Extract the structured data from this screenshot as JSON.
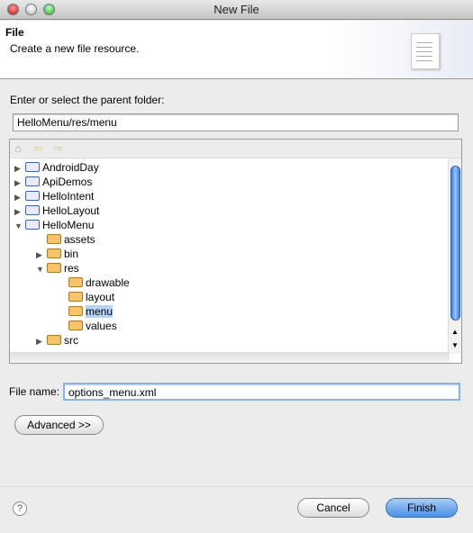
{
  "window": {
    "title": "New File"
  },
  "header": {
    "title": "File",
    "description": "Create a new file resource."
  },
  "parent_folder": {
    "label": "Enter or select the parent folder:",
    "value": "HelloMenu/res/menu"
  },
  "tree": {
    "items": [
      {
        "label": "AndroidDay",
        "type": "project",
        "level": 0,
        "expanded": false
      },
      {
        "label": "ApiDemos",
        "type": "project",
        "level": 0,
        "expanded": false
      },
      {
        "label": "HelloIntent",
        "type": "project",
        "level": 0,
        "expanded": false
      },
      {
        "label": "HelloLayout",
        "type": "project",
        "level": 0,
        "expanded": false
      },
      {
        "label": "HelloMenu",
        "type": "project",
        "level": 0,
        "expanded": true
      },
      {
        "label": "assets",
        "type": "folder",
        "level": 1,
        "expanded": null
      },
      {
        "label": "bin",
        "type": "folder",
        "level": 1,
        "expanded": false
      },
      {
        "label": "res",
        "type": "folder",
        "level": 1,
        "expanded": true
      },
      {
        "label": "drawable",
        "type": "folder",
        "level": 2,
        "expanded": null
      },
      {
        "label": "layout",
        "type": "folder",
        "level": 2,
        "expanded": null
      },
      {
        "label": "menu",
        "type": "folder",
        "level": 2,
        "expanded": null,
        "selected": true
      },
      {
        "label": "values",
        "type": "folder",
        "level": 2,
        "expanded": null
      },
      {
        "label": "src",
        "type": "folder",
        "level": 1,
        "expanded": false
      }
    ]
  },
  "file_name": {
    "label": "File name:",
    "value": "options_menu.xml"
  },
  "buttons": {
    "advanced": "Advanced >>",
    "cancel": "Cancel",
    "finish": "Finish"
  },
  "colors": {
    "selection": "#b5d2f7",
    "default_button": "#4a90e8"
  }
}
